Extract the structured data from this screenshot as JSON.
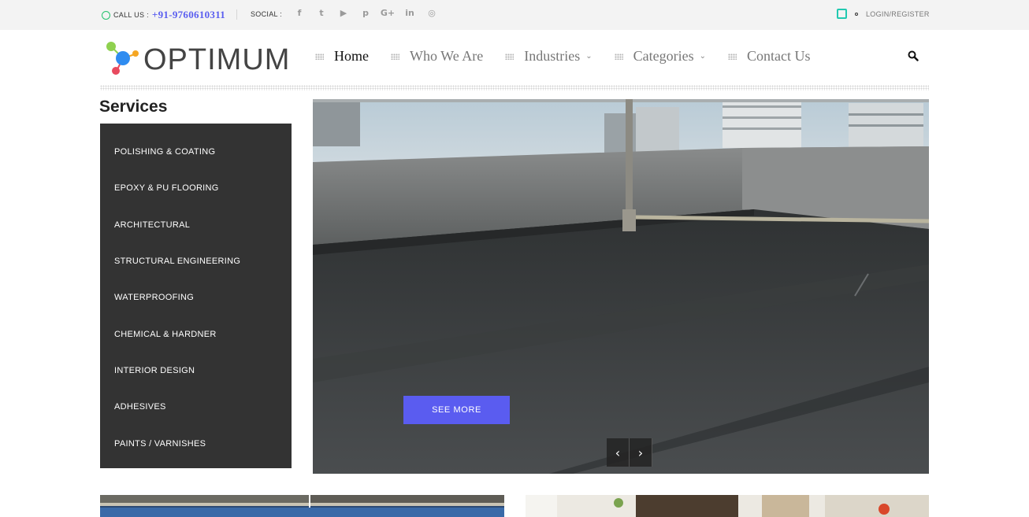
{
  "topbar": {
    "call_label": "CALL US :",
    "phone": "+91-9760610311",
    "social_label": "SOCIAL :",
    "social_icons": [
      {
        "name": "facebook-icon",
        "glyph": "f"
      },
      {
        "name": "twitter-icon",
        "glyph": "t"
      },
      {
        "name": "youtube-icon",
        "glyph": "▶"
      },
      {
        "name": "pinterest-icon",
        "glyph": "p"
      },
      {
        "name": "google-plus-icon",
        "glyph": "G+"
      },
      {
        "name": "linkedin-icon",
        "glyph": "in"
      },
      {
        "name": "instagram-icon",
        "glyph": "◎"
      }
    ],
    "login_label": "LOGIN/REGISTER"
  },
  "header": {
    "logo_text": "OPTIMUM",
    "nav": [
      {
        "label": "Home",
        "active": true,
        "dropdown": false
      },
      {
        "label": "Who We Are",
        "active": false,
        "dropdown": false
      },
      {
        "label": "Industries",
        "active": false,
        "dropdown": true
      },
      {
        "label": "Categories",
        "active": false,
        "dropdown": true
      },
      {
        "label": "Contact Us",
        "active": false,
        "dropdown": false
      }
    ]
  },
  "services": {
    "title": "Services",
    "items": [
      "POLISHING & COATING",
      "EPOXY & PU FLOORING",
      "ARCHITECTURAL",
      "STRUCTURAL ENGINEERING",
      "WATERPROOFING",
      "CHEMICAL & HARDNER",
      "INTERIOR DESIGN",
      "ADHESIVES",
      "PAINTS / VARNISHES"
    ]
  },
  "slider": {
    "button_label": "SEE MORE",
    "prev_icon": "‹",
    "next_icon": "›"
  },
  "colors": {
    "accent": "#5a5cf0",
    "sidebar_bg": "#333333",
    "topbar_bg": "#f3f3f3",
    "whatsapp": "#25c26e",
    "edit_icon": "#22c9b0"
  }
}
